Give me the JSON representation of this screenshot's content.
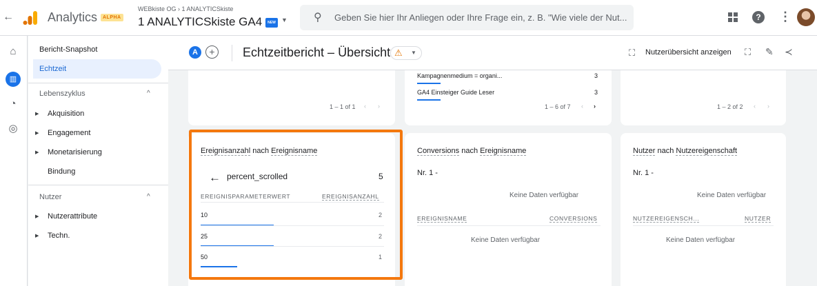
{
  "topbar": {
    "app_name": "Analytics",
    "badge": "ALPHA",
    "account_breadcrumb": "WEBkiste OG › 1 ANALYTICSkiste",
    "property_title": "1 ANALYTICSkiste GA4",
    "new_badge": "NEW",
    "search_placeholder": "Geben Sie hier Ihr Anliegen oder Ihre Frage ein, z. B. \"Wie viele der Nut..."
  },
  "sidebar": {
    "snapshot": "Bericht-Snapshot",
    "realtime": "Echtzeit",
    "lifecycle_group": "Lebenszyklus",
    "lifecycle_items": [
      "Akquisition",
      "Engagement",
      "Monetarisierung"
    ],
    "retention": "Bindung",
    "user_group": "Nutzer",
    "user_items": [
      "Nutzerattribute",
      "Techn."
    ]
  },
  "header": {
    "chip_label": "A",
    "title": "Echtzeitbericht – Übersicht",
    "user_view": "Nutzerübersicht anzeigen"
  },
  "top_cards": {
    "left_pager": "1 – 1 of 1",
    "middle_rows": [
      {
        "label": "Kampagnenmedium = organi...",
        "value": "3"
      },
      {
        "label": "GA4 Einsteiger Guide Leser",
        "value": "3"
      }
    ],
    "middle_pager": "1 – 6 of 7",
    "right_pager": "1 – 2 of 2"
  },
  "event_card": {
    "title_a": "Ereignisanzahl",
    "title_b": "nach",
    "title_c": "Ereignisname",
    "event_name": "percent_scrolled",
    "event_count": "5",
    "col_param": "EREIGNISPARAMETERWERT",
    "col_count": "EREIGNISANZAHL",
    "rows": [
      {
        "label": "10",
        "value": "2",
        "fraction": 1.0
      },
      {
        "label": "25",
        "value": "2",
        "fraction": 1.0
      },
      {
        "label": "50",
        "value": "1",
        "fraction": 0.5
      }
    ]
  },
  "conversions_card": {
    "title_a": "Conversions",
    "title_b": "nach",
    "title_c": "Ereignisname",
    "rank": "Nr. 1  -",
    "no_data_top": "Keine Daten verfügbar",
    "col_a": "EREIGNISNAME",
    "col_b": "CONVERSIONS",
    "no_data": "Keine Daten verfügbar"
  },
  "users_card": {
    "title_a": "Nutzer",
    "title_b": "nach",
    "title_c": "Nutzereigenschaft",
    "rank": "Nr. 1  -",
    "no_data_top": "Keine Daten verfügbar",
    "col_a": "NUTZEREIGENSCH...",
    "col_b": "NUTZER",
    "no_data": "Keine Daten verfügbar"
  },
  "colors": {
    "accent": "#1a73e8",
    "highlight": "#f4780e",
    "warning": "#e37400"
  },
  "icons": [
    "back-arrow-icon",
    "analytics-logo-icon",
    "search-icon",
    "apps-icon",
    "help-icon",
    "more-vert-icon",
    "home-icon",
    "reports-icon",
    "explore-icon",
    "advertising-icon",
    "warning-icon",
    "user-view-icon",
    "fullscreen-icon",
    "edit-icon",
    "share-icon"
  ]
}
